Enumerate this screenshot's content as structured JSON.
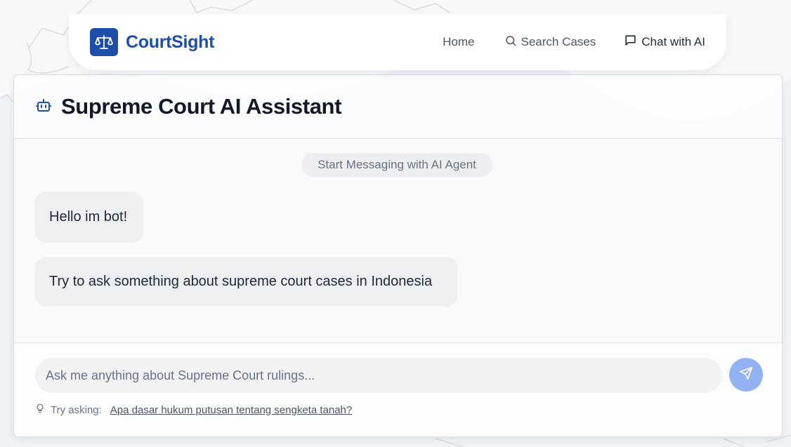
{
  "app": {
    "brand": "CourtSight"
  },
  "nav": {
    "home": "Home",
    "search": "Search Cases",
    "chat": "Chat with AI"
  },
  "chat": {
    "title": "Supreme Court AI Assistant",
    "system_message": "Start Messaging with AI Agent",
    "messages": [
      {
        "sender": "bot",
        "text": "Hello im bot!"
      },
      {
        "sender": "bot",
        "text": "Try to ask something about supreme court cases in Indonesia"
      }
    ],
    "input_placeholder": "Ask me anything about Supreme Court rulings...",
    "input_value": "",
    "hint_label": "Try asking:",
    "hint_suggestion": "Apa dasar hukum putusan tentang sengketa tanah?"
  },
  "icons": {
    "brand_logo": "scale-icon",
    "search": "search-icon",
    "chat": "message-square-icon",
    "assistant": "bot-icon",
    "send": "send-icon",
    "hint": "lightbulb-icon"
  },
  "colors": {
    "brand": "#1e4fa8",
    "send_button": "#93b2f3",
    "bubble": "#eeeff1",
    "page_background": "#f1f4f8"
  }
}
